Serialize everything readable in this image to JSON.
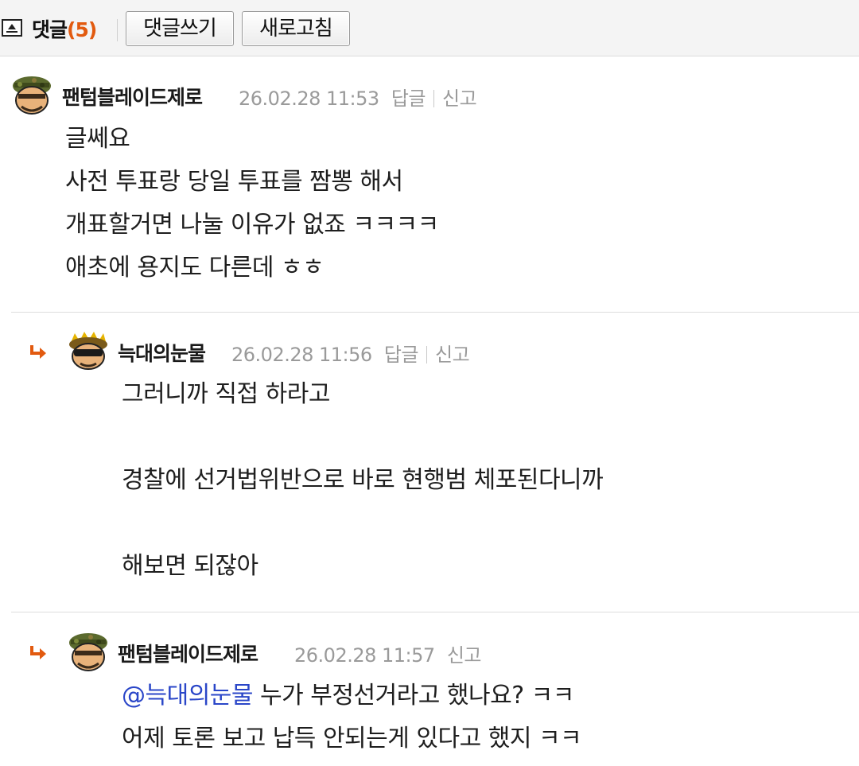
{
  "header": {
    "title": "댓글",
    "count": "(5)",
    "write_button": "댓글쓰기",
    "refresh_button": "새로고침"
  },
  "comments": [
    {
      "author": "팬텀블레이드제로",
      "datetime": "26.02.28 11:53",
      "reply_label": "답글",
      "report_label": "신고",
      "lines": [
        "글쎄요",
        "사전 투표랑 당일 투표를 짬뽕 해서",
        "개표할거면 나눌 이유가 없죠 ㅋㅋㅋㅋ",
        "애초에 용지도 다른데 ㅎㅎ"
      ]
    },
    {
      "author": "늑대의눈물",
      "datetime": "26.02.28 11:56",
      "reply_label": "답글",
      "report_label": "신고",
      "lines": [
        "그러니까 직접 하라고",
        "",
        "경찰에 선거법위반으로 바로 현행범 체포된다니까",
        "",
        "해보면 되잖아"
      ]
    },
    {
      "author": "팬텀블레이드제로",
      "datetime": "26.02.28 11:57",
      "report_label": "신고",
      "mention": "@늑대의눈물",
      "line1_rest": " 누가 부정선거라고 했나요? ㅋㅋ",
      "line2": "어제 토론 보고 납득 안되는게 있다고 했지 ㅋㅋ"
    }
  ],
  "colors": {
    "count": "#e25a0f",
    "reply_arrow": "#e25a0f",
    "mention": "#2a46c8",
    "meta": "#9a9a9a"
  },
  "icons": [
    "collapse-icon",
    "reply-arrow-icon",
    "avatar-camo",
    "avatar-sunglasses"
  ]
}
